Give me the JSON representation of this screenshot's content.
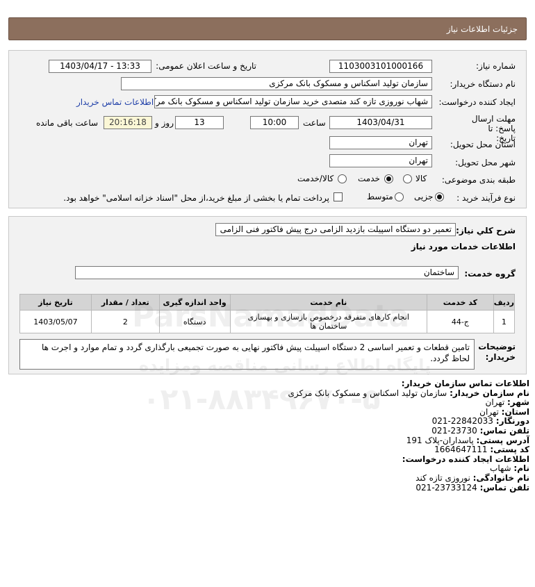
{
  "header": {
    "title": "جزئیات اطلاعات نیاز"
  },
  "details": {
    "need_number_label": "شماره نیاز:",
    "need_number": "1103003101000166",
    "announce_label": "تاریخ و ساعت اعلان عمومی:",
    "announce_value": "1403/04/17 - 13:33",
    "buyer_org_label": "نام دستگاه خریدار:",
    "buyer_org": "سازمان تولید اسکناس و مسکوک بانک مرکزی",
    "creator_label": "ایجاد کننده درخواست:",
    "creator": "شهاب نوروزی تازه کند متصدی خرید سازمان تولید اسکناس و مسکوک بانک مرکزی",
    "contact_link": "اطلاعات تماس خریدار",
    "deadline_label": "مهلت ارسال پاسخ: تا تاریخ:",
    "deadline_date": "1403/04/31",
    "time_label": "ساعت",
    "deadline_time": "10:00",
    "days_value": "13",
    "days_label": "روز و",
    "remaining_time": "20:16:18",
    "remaining_label": "ساعت باقی مانده",
    "province_label": "استان محل تحویل:",
    "province": "تهران",
    "city_label": "شهر محل تحویل:",
    "city": "تهران",
    "category_label": "طبقه بندی موضوعی:",
    "category_options": [
      "کالا",
      "خدمت",
      "کالا/خدمت"
    ],
    "category_selected": "خدمت",
    "process_label": "نوع فرآیند خرید :",
    "process_options": [
      "جزیی",
      "متوسط"
    ],
    "process_selected": "جزیی",
    "payment_note": "پرداخت تمام یا بخشی از مبلغ خرید،از محل \"اسناد خزانه اسلامی\" خواهد بود."
  },
  "summary": {
    "label": "شرح کلي نياز:",
    "value": "تعمیر دو دستگاه اسپیلت بازدید الزامی درج پیش فاکتور فنی الزامی",
    "services_title": "اطلاعات خدمات مورد نیاز",
    "service_group_label": "گروه خدمت:",
    "service_group": "ساختمان"
  },
  "table": {
    "headers": [
      "ردیف",
      "کد خدمت",
      "نام خدمت",
      "واحد اندازه گیری",
      "تعداد / مقدار",
      "تاریخ نیاز"
    ],
    "rows": [
      {
        "row": "1",
        "code": "ج-44",
        "name": "انجام کارهای متفرقه درخصوص بازسازی و بهسازی ساختمان ها",
        "unit": "دستگاه",
        "qty": "2",
        "date": "1403/05/07"
      }
    ]
  },
  "buyer_notes": {
    "label": "توضیحات خریدار:",
    "value": "تامین قطعات و تعمیر اساسی 2 دستگاه اسپیلت پیش فاکتور نهایی به صورت تجمیعی بارگذاری گردد و تمام موارد و اجرت ها لحاظ گردد."
  },
  "contact": {
    "org_title": "اطلاعات تماس سازمان خریدار:",
    "org_name_label": "نام سازمان خریدار:",
    "org_name": "سازمان تولید اسکناس و مسکوک بانک مرکزی",
    "city_label": "شهر:",
    "city": "تهران",
    "province_label": "استان:",
    "province": "تهران",
    "fax_label": "دورنگار:",
    "fax": "22842033-021",
    "phone_label": "تلفن تماس:",
    "phone": "23730-021",
    "address_label": "آدرس پستی:",
    "address": "پاسداران-پلاک 191",
    "postal_label": "کد پستی:",
    "postal": "1664647111",
    "creator_title": "اطلاعات ایجاد کننده درخواست:",
    "first_name_label": "نام:",
    "first_name": "شهاب",
    "last_name_label": "نام خانوادگی:",
    "last_name": "نوروزی تازه کند",
    "creator_phone_label": "تلفن تماس:",
    "creator_phone": "23733124-021"
  },
  "watermark": {
    "brand": "ParsNamadData",
    "tagline": "پایگاه اطلاع رسانی مناقصه ومزایده",
    "phone": "۰۲۱-۸۸۳۴۹۶۷۰-۵"
  }
}
